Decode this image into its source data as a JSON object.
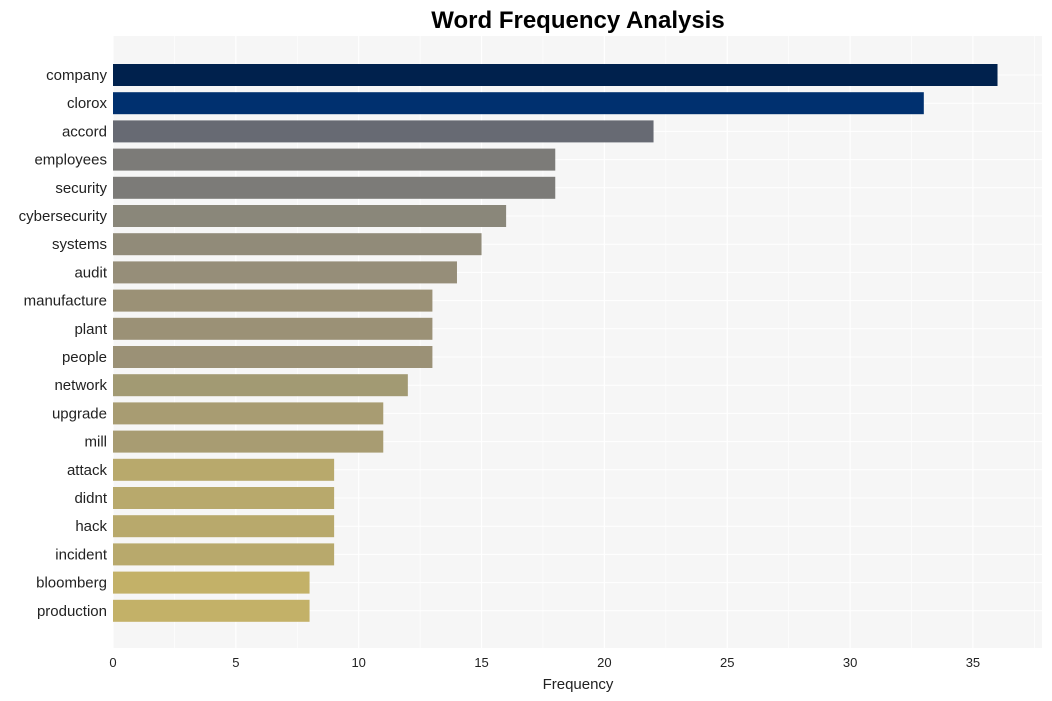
{
  "chart_data": {
    "type": "bar",
    "orientation": "horizontal",
    "title": "Word Frequency Analysis",
    "xlabel": "Frequency",
    "ylabel": "",
    "xlim": [
      0,
      37.8
    ],
    "xticks": [
      0,
      5,
      10,
      15,
      20,
      25,
      30,
      35
    ],
    "grid": true,
    "legend": "none",
    "categories": [
      "company",
      "clorox",
      "accord",
      "employees",
      "security",
      "cybersecurity",
      "systems",
      "audit",
      "manufacture",
      "plant",
      "people",
      "network",
      "upgrade",
      "mill",
      "attack",
      "didnt",
      "hack",
      "incident",
      "bloomberg",
      "production"
    ],
    "values": [
      36,
      33,
      22,
      18,
      18,
      16,
      15,
      14,
      13,
      13,
      13,
      12,
      11,
      11,
      9,
      9,
      9,
      9,
      8,
      8
    ],
    "colors": [
      "#00214d",
      "#00306f",
      "#676a73",
      "#7c7b78",
      "#7c7b78",
      "#8a877a",
      "#918b79",
      "#968e79",
      "#9b9176",
      "#9b9176",
      "#9b9176",
      "#a29a73",
      "#a89c72",
      "#a89c72",
      "#b8a96c",
      "#b8a96c",
      "#b8a96c",
      "#b8a96c",
      "#c3b168",
      "#c3b168"
    ]
  }
}
